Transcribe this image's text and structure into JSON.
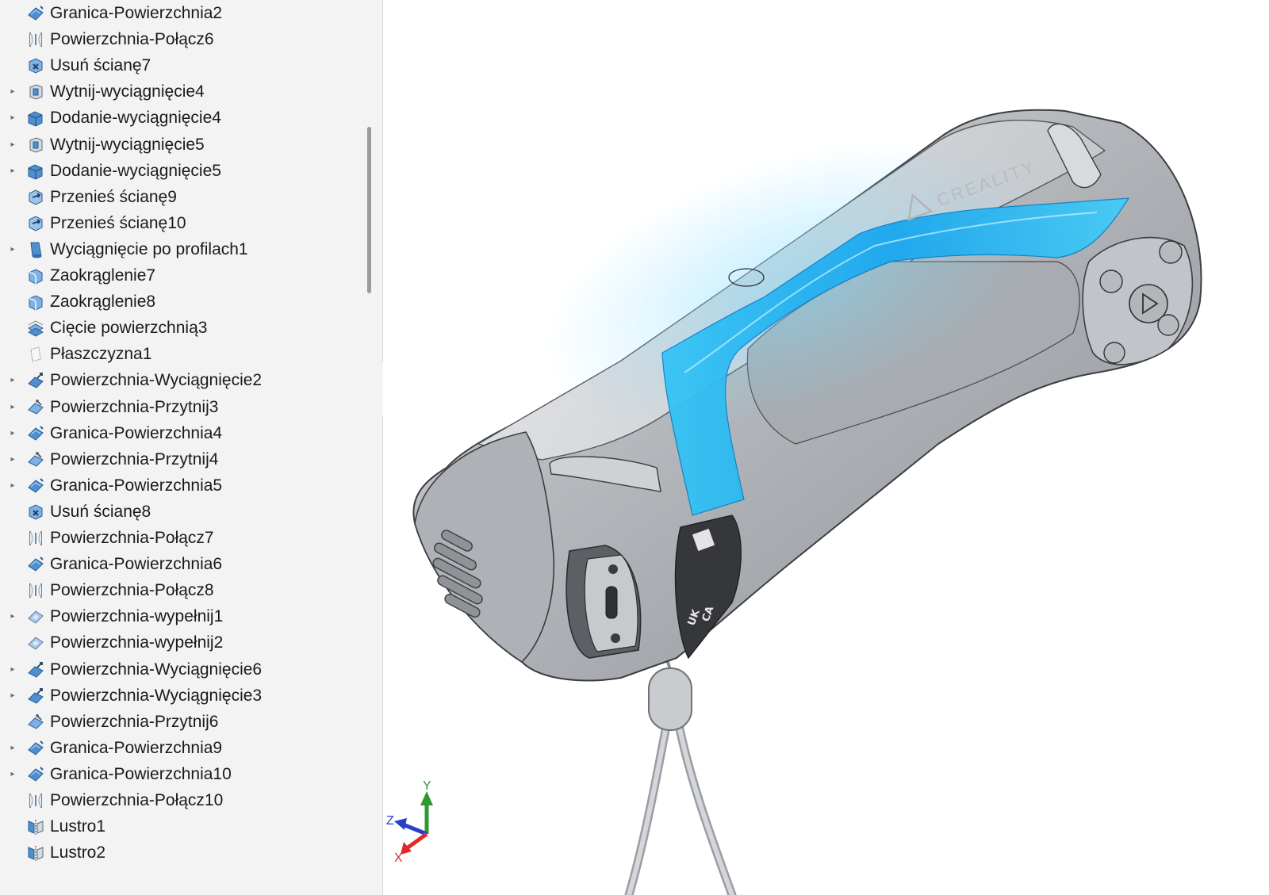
{
  "feature_tree": {
    "items": [
      {
        "label": "Granica-Powierzchnia2",
        "icon": "boundary-surface-icon",
        "expandable": false
      },
      {
        "label": "Powierzchnia-Połącz6",
        "icon": "knit-surface-icon",
        "expandable": false
      },
      {
        "label": "Usuń ścianę7",
        "icon": "delete-face-icon",
        "expandable": false
      },
      {
        "label": "Wytnij-wyciągnięcie4",
        "icon": "extruded-cut-icon",
        "expandable": true
      },
      {
        "label": "Dodanie-wyciągnięcie4",
        "icon": "extruded-boss-icon",
        "expandable": true
      },
      {
        "label": "Wytnij-wyciągnięcie5",
        "icon": "extruded-cut-icon",
        "expandable": true
      },
      {
        "label": "Dodanie-wyciągnięcie5",
        "icon": "extruded-boss-icon",
        "expandable": true
      },
      {
        "label": "Przenieś ścianę9",
        "icon": "move-face-icon",
        "expandable": false
      },
      {
        "label": "Przenieś ścianę10",
        "icon": "move-face-icon",
        "expandable": false
      },
      {
        "label": "Wyciągnięcie po profilach1",
        "icon": "loft-icon",
        "expandable": true
      },
      {
        "label": "Zaokrąglenie7",
        "icon": "fillet-icon",
        "expandable": false
      },
      {
        "label": "Zaokrąglenie8",
        "icon": "fillet-icon",
        "expandable": false
      },
      {
        "label": "Cięcie powierzchnią3",
        "icon": "surface-cut-icon",
        "expandable": false
      },
      {
        "label": "Płaszczyzna1",
        "icon": "plane-icon",
        "expandable": false
      },
      {
        "label": "Powierzchnia-Wyciągnięcie2",
        "icon": "surface-extrude-icon",
        "expandable": true
      },
      {
        "label": "Powierzchnia-Przytnij3",
        "icon": "trim-surface-icon",
        "expandable": true
      },
      {
        "label": "Granica-Powierzchnia4",
        "icon": "boundary-surface-icon",
        "expandable": true
      },
      {
        "label": "Powierzchnia-Przytnij4",
        "icon": "trim-surface-icon",
        "expandable": true
      },
      {
        "label": "Granica-Powierzchnia5",
        "icon": "boundary-surface-icon",
        "expandable": true
      },
      {
        "label": "Usuń ścianę8",
        "icon": "delete-face-icon",
        "expandable": false
      },
      {
        "label": "Powierzchnia-Połącz7",
        "icon": "knit-surface-icon",
        "expandable": false
      },
      {
        "label": "Granica-Powierzchnia6",
        "icon": "boundary-surface-icon",
        "expandable": false
      },
      {
        "label": "Powierzchnia-Połącz8",
        "icon": "knit-surface-icon",
        "expandable": false
      },
      {
        "label": "Powierzchnia-wypełnij1",
        "icon": "filled-surface-icon",
        "expandable": true
      },
      {
        "label": "Powierzchnia-wypełnij2",
        "icon": "filled-surface-icon",
        "expandable": false
      },
      {
        "label": "Powierzchnia-Wyciągnięcie6",
        "icon": "surface-extrude-icon",
        "expandable": true
      },
      {
        "label": "Powierzchnia-Wyciągnięcie3",
        "icon": "surface-extrude-icon",
        "expandable": true
      },
      {
        "label": "Powierzchnia-Przytnij6",
        "icon": "trim-surface-icon",
        "expandable": false
      },
      {
        "label": "Granica-Powierzchnia9",
        "icon": "boundary-surface-icon",
        "expandable": true
      },
      {
        "label": "Granica-Powierzchnia10",
        "icon": "boundary-surface-icon",
        "expandable": true
      },
      {
        "label": "Powierzchnia-Połącz10",
        "icon": "knit-surface-icon",
        "expandable": false
      },
      {
        "label": "Lustro1",
        "icon": "mirror-icon",
        "expandable": false
      },
      {
        "label": "Lustro2",
        "icon": "mirror-icon",
        "expandable": false
      }
    ]
  },
  "viewport": {
    "model_brand_text": "CREALITY",
    "label_marks": [
      "UK",
      "CA"
    ],
    "triad": {
      "x": "X",
      "y": "Y",
      "z": "Z"
    }
  },
  "colors": {
    "panel_bg": "#f3f3f3",
    "icon_blue": "#4f8fd0",
    "accent_cyan": "#1fb8f0",
    "body_gray": "#b9bcc0",
    "axis_x": "#e02a2a",
    "axis_y": "#2e9a2e",
    "axis_z": "#2a3fc9"
  }
}
